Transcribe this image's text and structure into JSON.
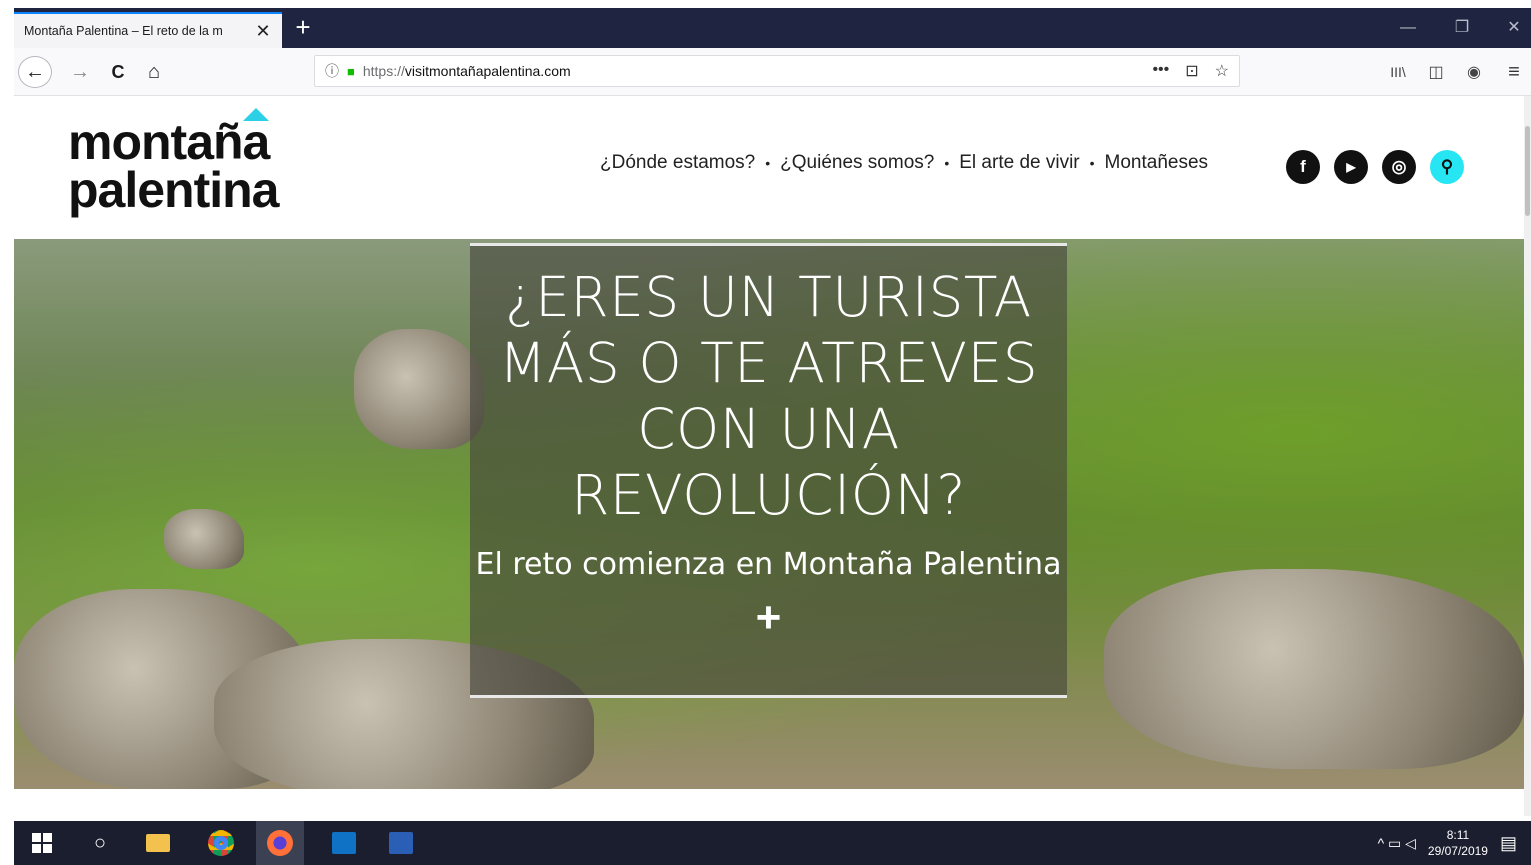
{
  "browser": {
    "tab_title": "Montaña Palentina – El reto de la m",
    "tab_close": "✕",
    "new_tab": "+",
    "window_controls": {
      "minimize": "—",
      "restore": "❐",
      "close": "✕"
    },
    "nav": {
      "back": "←",
      "forward": "→",
      "reload": "C",
      "home": "⌂"
    },
    "url": {
      "scheme": "https://",
      "host": "visitmontañapalentina.com",
      "info_icon": "ⓘ",
      "lock_icon": "🔒",
      "page_actions": "•••",
      "pocket_icon": "⊡",
      "bookmark_icon": "☆"
    },
    "toolbar_right": {
      "library": "III\\",
      "sidebar": "◫",
      "account": "◉",
      "menu": "≡"
    }
  },
  "site": {
    "logo": {
      "line1": "montaña",
      "line2": "palentina"
    },
    "menu": [
      {
        "label": "¿Dónde estamos?"
      },
      {
        "label": "¿Quiénes somos?"
      },
      {
        "label": "El arte de vivir"
      },
      {
        "label": "Montañeses"
      }
    ],
    "menu_separator": "•",
    "social": {
      "facebook": "f",
      "youtube": "▶",
      "instagram": "◎",
      "search": "⚲"
    },
    "hero": {
      "title": "¿ERES UN TURISTA MÁS O TE ATREVES CON UNA REVOLUCIÓN?",
      "subtitle": "El reto comienza en Montaña Palentina",
      "plus": "+"
    },
    "colors": {
      "accent": "#2bcfe6",
      "search_bg": "#27e6f3"
    }
  },
  "taskbar": {
    "search_icon": "○",
    "tray_icons": "^ ▭ ◁",
    "time": "8:11",
    "date": "29/07/2019",
    "notification_icon": "▤",
    "apps": [
      "file-explorer-icon",
      "chrome-icon",
      "firefox-icon",
      "outlook-icon",
      "word-icon"
    ]
  }
}
